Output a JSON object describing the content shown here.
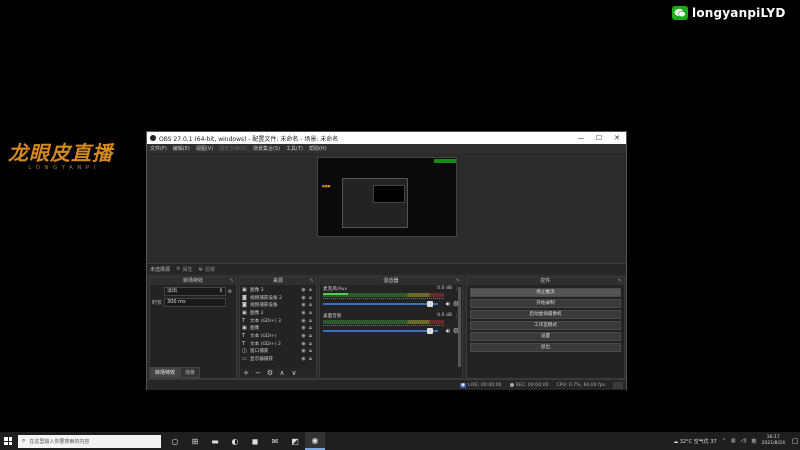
{
  "desktop": {
    "wechat_id": "longyanpiLYD",
    "logo_main": "龙眼皮直播",
    "logo_sub": "LONGYANPI"
  },
  "obs": {
    "title": "OBS 27.0.1 (64-bit, windows) - 配置文件: 未命名 - 场景: 未命名",
    "window_controls": {
      "minimize": "—",
      "maximize": "☐",
      "close": "✕"
    },
    "menus": [
      {
        "label": "文件(F)",
        "enabled": true
      },
      {
        "label": "编辑(E)",
        "enabled": true
      },
      {
        "label": "视图(V)",
        "enabled": true
      },
      {
        "label": "固定文档(D)",
        "enabled": false
      },
      {
        "label": "场景集合(S)",
        "enabled": true
      },
      {
        "label": "工具(T)",
        "enabled": true
      },
      {
        "label": "帮助(H)",
        "enabled": true
      }
    ],
    "scene_bar": {
      "name": "未选择源",
      "properties": "属性",
      "filters": "滤镜"
    },
    "transitions": {
      "header": "转场特效",
      "type": "淡出",
      "duration_label": "时长",
      "duration": "300 ms",
      "tabs": [
        "转场特效",
        "场景"
      ]
    },
    "sources": {
      "header": "来源",
      "items": [
        {
          "icon": "image-icon",
          "glyph": "▣",
          "name": "图像 3"
        },
        {
          "icon": "camera-icon",
          "glyph": "◙",
          "name": "视频捕获设备 2"
        },
        {
          "icon": "camera-icon",
          "glyph": "◙",
          "name": "视频捕获设备"
        },
        {
          "icon": "image-icon",
          "glyph": "▣",
          "name": "图像 2"
        },
        {
          "icon": "text-icon",
          "glyph": "T",
          "name": "文本 (GDI+) 3"
        },
        {
          "icon": "image-icon",
          "glyph": "▣",
          "name": "图像"
        },
        {
          "icon": "text-icon",
          "glyph": "T",
          "name": "文本 (GDI+)"
        },
        {
          "icon": "text-icon",
          "glyph": "T",
          "name": "文本 (GDI+) 2"
        },
        {
          "icon": "window-icon",
          "glyph": "◫",
          "name": "窗口捕获"
        },
        {
          "icon": "monitor-icon",
          "glyph": "▭",
          "name": "显示器捕获"
        }
      ],
      "toolbar": [
        "+",
        "−",
        "⚙",
        "∧",
        "∨"
      ]
    },
    "mixer": {
      "header": "混音器",
      "channels": [
        {
          "name": "麦克风/Aux",
          "db": "0.0 dB",
          "level": 0.2,
          "volume": 0.9
        },
        {
          "name": "桌面音频",
          "db": "0.0 dB",
          "level": 0.0,
          "volume": 0.9
        }
      ]
    },
    "controls": {
      "header": "控件",
      "buttons": [
        "停止推流",
        "开始录制",
        "启动虚拟摄像机",
        "工作室模式",
        "设置",
        "退出"
      ],
      "active_index": 0
    },
    "status": {
      "live": "LIVE: 00:00:00",
      "rec": "REC: 00:00:00",
      "cpu": "CPU: 0.7%, 60.00 fps"
    }
  },
  "taskbar": {
    "search_placeholder": "在这里输入你要搜索的内容",
    "apps": [
      {
        "icon": "task-view-icon",
        "glyph": "○"
      },
      {
        "icon": "widgets-icon",
        "glyph": "⊞"
      },
      {
        "icon": "file-explorer-icon",
        "glyph": "▬"
      },
      {
        "icon": "edge-icon",
        "glyph": "◐"
      },
      {
        "icon": "store-icon",
        "glyph": "◼"
      },
      {
        "icon": "mail-icon",
        "glyph": "✉"
      },
      {
        "icon": "app-icon",
        "glyph": "◩"
      },
      {
        "icon": "obs-icon",
        "glyph": "◉"
      }
    ],
    "weather": "32°C 空气优 37",
    "ime": "英",
    "time": "16:17",
    "date": "2021/8/24"
  },
  "colors": {
    "accent_blue": "#3a6fc8",
    "meter_green": "#4ccf4c",
    "logo_orange": "#d48a1e",
    "wechat_green": "#1aad19"
  }
}
